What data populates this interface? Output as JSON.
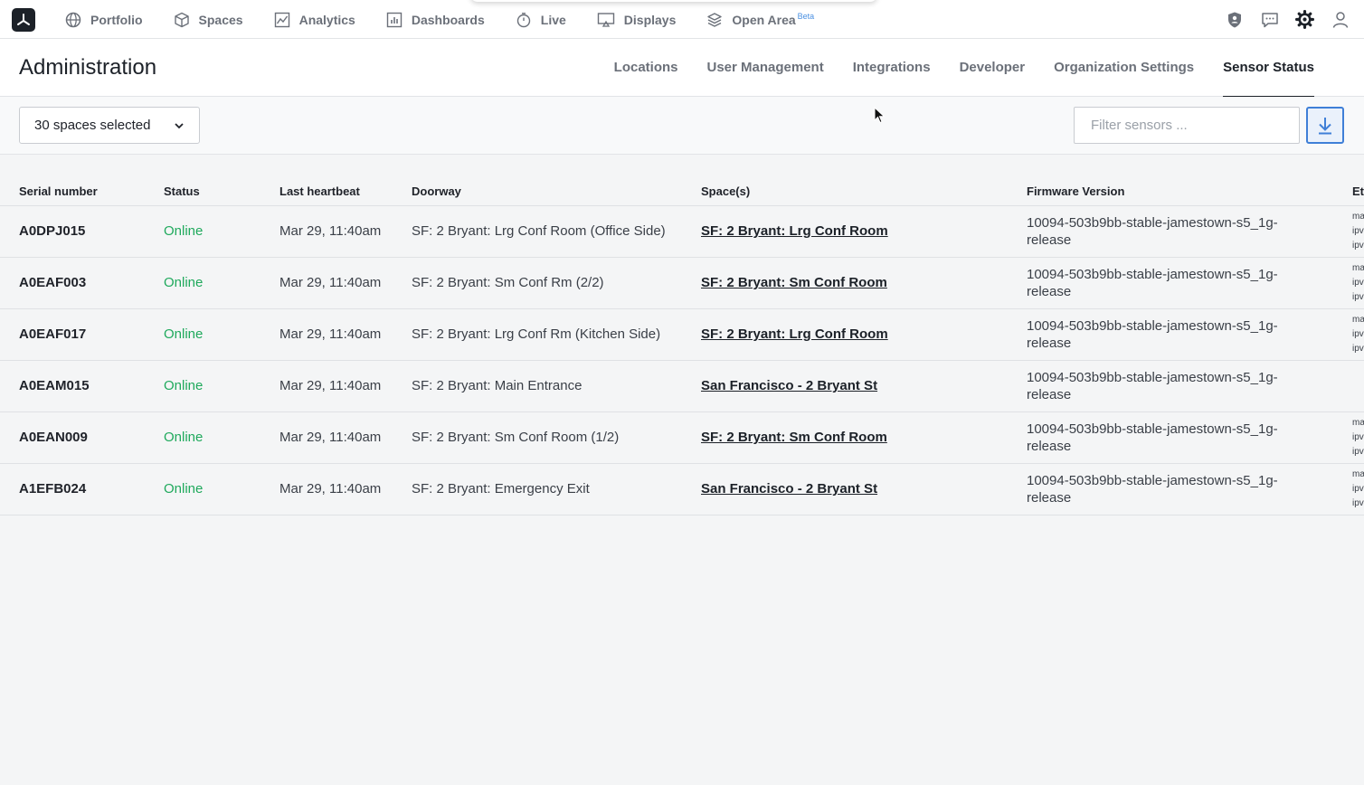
{
  "nav": {
    "items": [
      {
        "label": "Portfolio",
        "icon": "globe-icon"
      },
      {
        "label": "Spaces",
        "icon": "cube-icon"
      },
      {
        "label": "Analytics",
        "icon": "chart-icon"
      },
      {
        "label": "Dashboards",
        "icon": "bar-chart-icon"
      },
      {
        "label": "Live",
        "icon": "stopwatch-icon"
      },
      {
        "label": "Displays",
        "icon": "monitor-icon"
      },
      {
        "label": "Open Area",
        "icon": "layers-icon",
        "badge": "Beta"
      }
    ],
    "right_icons": [
      "shield-icon",
      "chat-icon",
      "gear-icon",
      "user-icon"
    ]
  },
  "admin": {
    "title": "Administration",
    "tabs": [
      "Locations",
      "User Management",
      "Integrations",
      "Developer",
      "Organization Settings",
      "Sensor Status"
    ],
    "active_tab": "Sensor Status"
  },
  "toolbar": {
    "spaces_selected": "30 spaces selected",
    "filter_placeholder": "Filter sensors ..."
  },
  "table": {
    "headers": [
      "Serial number",
      "Status",
      "Last heartbeat",
      "Doorway",
      "Space(s)",
      "Firmware Version",
      "Et"
    ],
    "rows": [
      {
        "serial": "A0DPJ015",
        "status": "Online",
        "heartbeat": "Mar 29, 11:40am",
        "doorway": "SF: 2 Bryant: Lrg Conf Room (Office Side)",
        "space": "SF: 2 Bryant: Lrg Conf Room",
        "fw1": "10094-503b9bb-stable-jamestown-s5_1g-",
        "fw2": "release",
        "eth": [
          "ma",
          "ipv",
          "ipv"
        ]
      },
      {
        "serial": "A0EAF003",
        "status": "Online",
        "heartbeat": "Mar 29, 11:40am",
        "doorway": "SF: 2 Bryant: Sm Conf Rm (2/2)",
        "space": "SF: 2 Bryant: Sm Conf Room",
        "fw1": "10094-503b9bb-stable-jamestown-s5_1g-",
        "fw2": "release",
        "eth": [
          "ma",
          "ipv",
          "ipv"
        ]
      },
      {
        "serial": "A0EAF017",
        "status": "Online",
        "heartbeat": "Mar 29, 11:40am",
        "doorway": "SF: 2 Bryant: Lrg Conf Rm (Kitchen Side)",
        "space": "SF: 2 Bryant: Lrg Conf Room",
        "fw1": "10094-503b9bb-stable-jamestown-s5_1g-",
        "fw2": "release",
        "eth": [
          "ma",
          "ipv",
          "ipv"
        ]
      },
      {
        "serial": "A0EAM015",
        "status": "Online",
        "heartbeat": "Mar 29, 11:40am",
        "doorway": "SF: 2 Bryant: Main Entrance",
        "space": "San Francisco - 2 Bryant St",
        "fw1": "10094-503b9bb-stable-jamestown-s5_1g-",
        "fw2": "release",
        "eth": []
      },
      {
        "serial": "A0EAN009",
        "status": "Online",
        "heartbeat": "Mar 29, 11:40am",
        "doorway": "SF: 2 Bryant: Sm Conf Room (1/2)",
        "space": "SF: 2 Bryant: Sm Conf Room",
        "fw1": "10094-503b9bb-stable-jamestown-s5_1g-",
        "fw2": "release",
        "eth": [
          "ma",
          "ipv",
          "ipv"
        ]
      },
      {
        "serial": "A1EFB024",
        "status": "Online",
        "heartbeat": "Mar 29, 11:40am",
        "doorway": "SF: 2 Bryant: Emergency Exit",
        "space": "San Francisco - 2 Bryant St",
        "fw1": "10094-503b9bb-stable-jamestown-s5_1g-",
        "fw2": "release",
        "eth": [
          "ma",
          "ipv",
          "ipv"
        ]
      }
    ]
  },
  "colors": {
    "status_online": "#1fa95c",
    "accent_blue": "#3f7fd7",
    "text_dark": "#1c2128"
  }
}
